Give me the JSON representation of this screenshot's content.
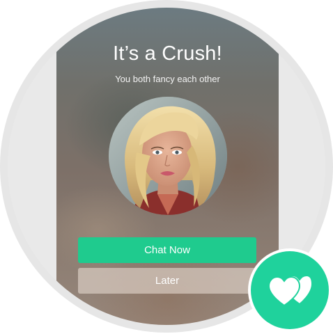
{
  "screen": {
    "title": "It’s a Crush!",
    "subtitle": "You both fancy each other",
    "chat_button_label": "Chat Now",
    "later_button_label": "Later"
  },
  "icons": {
    "badge": "two-hearts-icon",
    "avatar": "profile-photo"
  },
  "colors": {
    "accent": "#1fcb8e",
    "badge": "#1fd29c",
    "text": "#ffffff"
  }
}
